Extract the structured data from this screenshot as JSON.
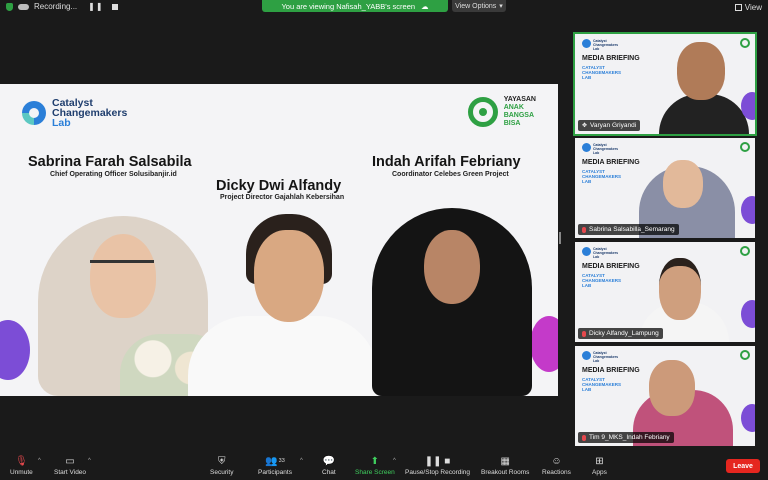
{
  "topbar": {
    "recording_label": "Recording...",
    "viewing_banner": "You are viewing Nafisah_YABB's screen",
    "view_options_label": "View Options",
    "view_label": "View"
  },
  "share": {
    "brand": {
      "line1": "Catalyst",
      "line2": "Changemakers",
      "line3": "Lab"
    },
    "partner": {
      "line1": "YAYASAN",
      "line2": "ANAK",
      "line3": "BANGSA",
      "line4": "BISA"
    },
    "speakers": [
      {
        "name": "Sabrina Farah Salsabila",
        "role": "Chief Operating Officer Solusibanjir.id"
      },
      {
        "name": "Dicky Dwi Alfandy",
        "role": "Project Director Gajahlah Kebersihan"
      },
      {
        "name": "Indah Arifah Febriany",
        "role": "Coordinator Celebes Green Project"
      }
    ]
  },
  "thumbnails": [
    {
      "title": "MEDIA BRIEFING",
      "sub1": "CATALYST",
      "sub2": "CHANGEMAKERS",
      "sub3": "LAB",
      "logo1": "Catalyst",
      "logo2": "Changemakers",
      "logo3": "Lab",
      "participant": "Varyan Griyandi",
      "muted": false
    },
    {
      "title": "MEDIA BRIEFING",
      "sub1": "CATALYST",
      "sub2": "CHANGEMAKERS",
      "sub3": "LAB",
      "logo1": "Catalyst",
      "logo2": "Changemakers",
      "logo3": "Lab",
      "participant": "Sabrina Salsabilla_Semarang",
      "muted": true
    },
    {
      "title": "MEDIA BRIEFING",
      "sub1": "CATALYST",
      "sub2": "CHANGEMAKERS",
      "sub3": "LAB",
      "logo1": "Catalyst",
      "logo2": "Changemakers",
      "logo3": "Lab",
      "participant": "Dicky Alfandy_Lampung",
      "muted": true
    },
    {
      "title": "MEDIA BRIEFING",
      "sub1": "CATALYST",
      "sub2": "CHANGEMAKERS",
      "sub3": "LAB",
      "logo1": "Catalyst",
      "logo2": "Changemakers",
      "logo3": "Lab",
      "participant": "Tim 9_MKS_Indah Febriany",
      "muted": true
    }
  ],
  "toolbar": {
    "unmute": "Unmute",
    "start_video": "Start Video",
    "security": "Security",
    "participants": "Participants",
    "participant_count": "33",
    "chat": "Chat",
    "share_screen": "Share Screen",
    "pause_recording": "Pause/Stop Recording",
    "breakout_rooms": "Breakout Rooms",
    "reactions": "Reactions",
    "apps": "Apps",
    "leave": "Leave"
  },
  "colors": {
    "accent_green": "#2ea043",
    "leave_red": "#e5261f",
    "brand_blue": "#2b7fd8"
  }
}
